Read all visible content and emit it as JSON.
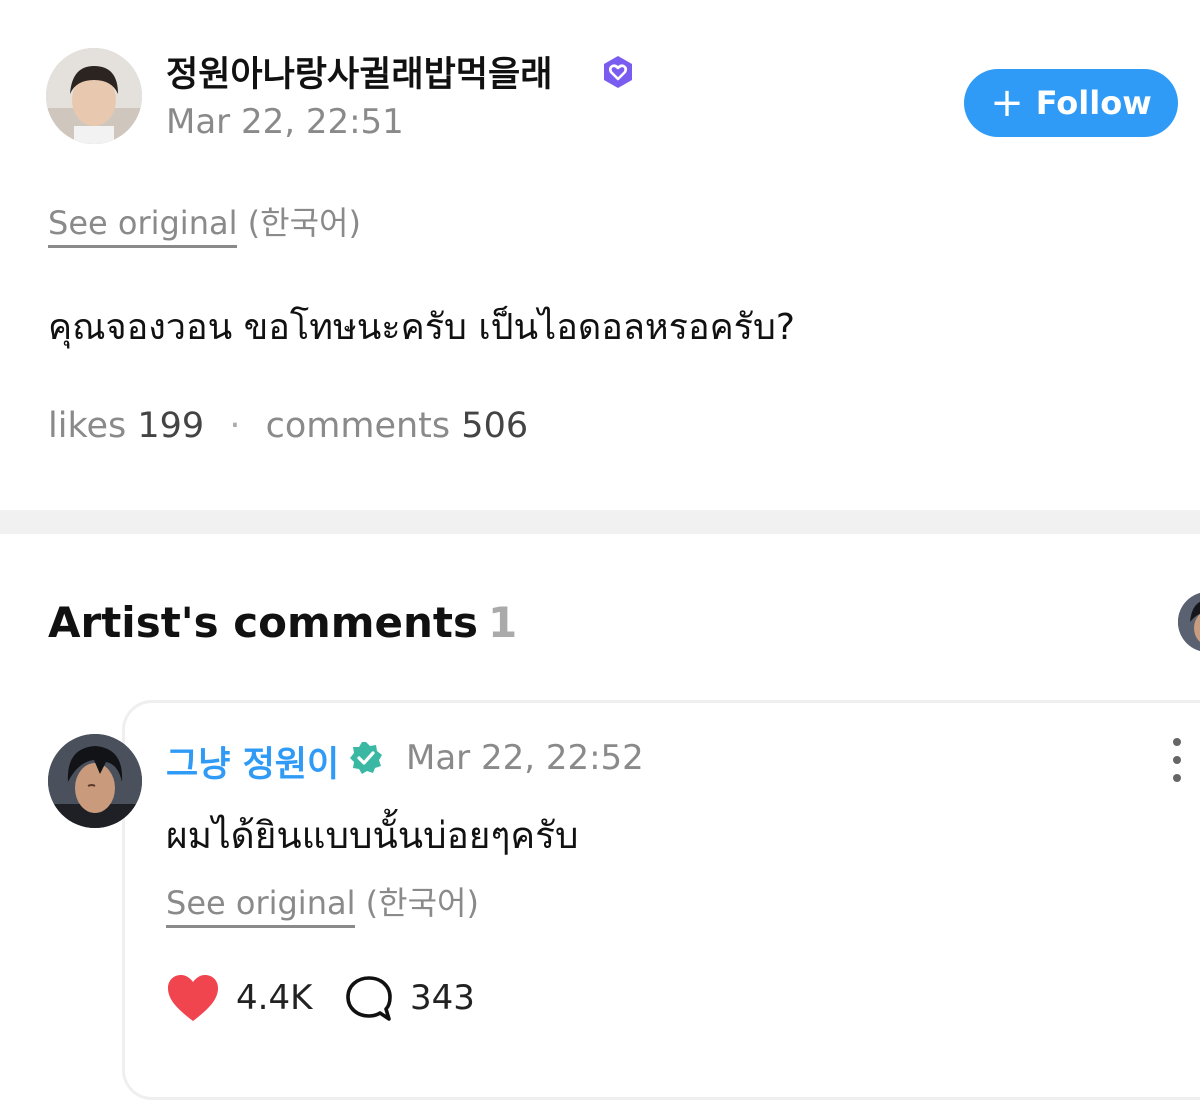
{
  "post": {
    "author_name": "정원아나랑사귈래밥먹을래",
    "badge_icon": "verified-heart-icon",
    "time": "Mar 22, 22:51",
    "follow_label": "Follow",
    "follow_icon": "plus-icon",
    "see_original": "See original",
    "original_lang": "(한국어)",
    "body": "คุณจองวอน ขอโทษนะครับ เป็นไอดอลหรอครับ?",
    "likes_label": "likes",
    "likes_count": "199",
    "comments_label": "comments",
    "comments_count": "506"
  },
  "artist_comments": {
    "title": "Artist's comments",
    "count": "1"
  },
  "comment": {
    "author_name": "그냥 정원이",
    "badge_icon": "verified-check-icon",
    "time": "Mar 22, 22:52",
    "body": "ผมได้ยินแบบนั้นบ่อยๆครับ",
    "see_original": "See original",
    "original_lang": "(한국어)",
    "likes": "4.4K",
    "replies": "343"
  },
  "colors": {
    "accent_blue": "#2f9bf7",
    "heart_red": "#f0454f",
    "badge_purple": "#7b5cf0",
    "muted_text": "#8a8a8a"
  }
}
